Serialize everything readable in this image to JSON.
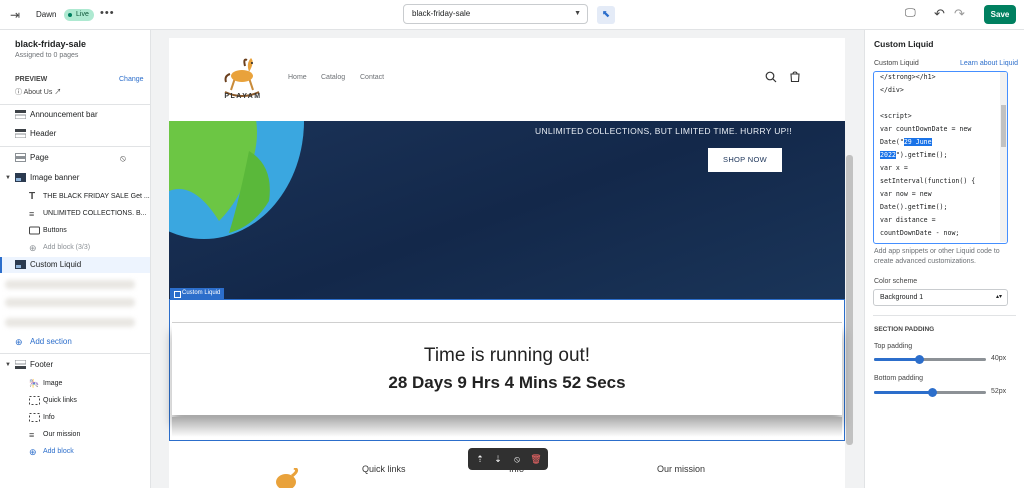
{
  "topbar": {
    "theme_name": "Dawn",
    "live_badge": "Live",
    "more": "•••",
    "template_select": "black-friday-sale",
    "save_label": "Save"
  },
  "sidebar": {
    "title": "black-friday-sale",
    "subtitle": "Assigned to 0 pages",
    "preview_label": "PREVIEW",
    "change_label": "Change",
    "preview_value": "About Us",
    "items": {
      "announcement": "Announcement bar",
      "header": "Header",
      "page": "Page",
      "image_banner": "Image banner",
      "banner_heading": "THE BLACK FRIDAY SALE Get ...",
      "banner_text": "UNLIMITED COLLECTIONS. B...",
      "banner_buttons": "Buttons",
      "add_block_banner": "Add block (3/3)",
      "custom_liquid": "Custom Liquid",
      "add_section": "Add section",
      "footer": "Footer",
      "footer_image": "Image",
      "footer_quick_links": "Quick links",
      "footer_info": "Info",
      "footer_mission": "Our mission",
      "footer_add_block": "Add block"
    }
  },
  "preview": {
    "logo_text": "PLAYAM",
    "nav": {
      "home": "Home",
      "catalog": "Catalog",
      "contact": "Contact"
    },
    "banner_heading": "UNLIMITED COLLECTIONS, BUT LIMITED TIME. HURRY UP!!",
    "shop_now": "SHOP NOW",
    "liquid_tag": "Custom Liquid",
    "countdown_title": "Time is running out!",
    "countdown_value": "28 Days 9 Hrs 4 Mins 52 Secs",
    "footer": {
      "quick_links": "Quick links",
      "info": "Info",
      "mission": "Our mission"
    }
  },
  "right_panel": {
    "title": "Custom Liquid",
    "field_label": "Custom Liquid",
    "learn_link": "Learn about Liquid",
    "code_lines": [
      "</strong></h1>",
      "</div>",
      "",
      "<script>",
      "var countDownDate = new",
      "Date(\"29 June",
      "2022\").getTime();",
      "var x =",
      "setInterval(function() {",
      "var now = new",
      "Date().getTime();",
      "var distance =",
      "countDownDate - now;"
    ],
    "code_date_highlight_1": "29 June",
    "code_date_highlight_2": "2022",
    "help_text": "Add app snippets or other Liquid code to create advanced customizations.",
    "color_scheme_label": "Color scheme",
    "color_scheme_value": "Background 1",
    "section_padding_title": "SECTION PADDING",
    "top_padding_label": "Top padding",
    "top_padding_value": "40px",
    "top_padding_fraction": 0.4,
    "bottom_padding_label": "Bottom padding",
    "bottom_padding_value": "52px",
    "bottom_padding_fraction": 0.52
  },
  "colors": {
    "accent": "#2c6ecb",
    "save_green": "#008060",
    "banner_navy": "#1b3358"
  }
}
